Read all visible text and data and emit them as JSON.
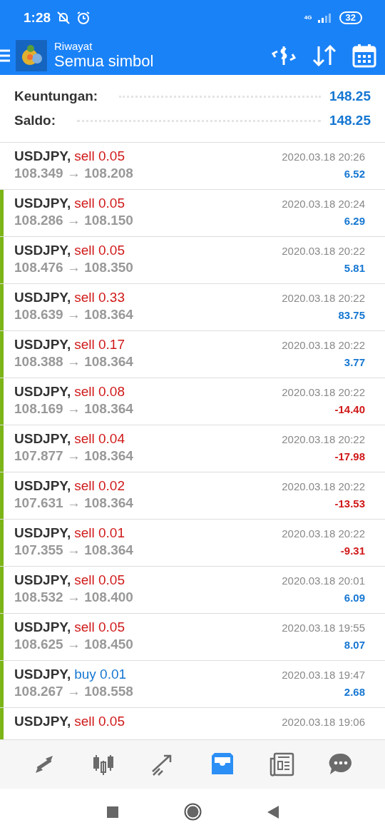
{
  "status_bar": {
    "time": "1:28",
    "network": "4G",
    "battery": "32"
  },
  "header": {
    "title": "Riwayat",
    "subtitle": "Semua simbol"
  },
  "summary": [
    {
      "label": "Keuntungan:",
      "value": "148.25"
    },
    {
      "label": "Saldo:",
      "value": "148.25"
    }
  ],
  "deals": [
    {
      "symbol": "USDJPY,",
      "type": "sell",
      "volume": "0.05",
      "buy": false,
      "prices": "108.349 → 108.208",
      "time": "2020.03.18 20:26",
      "profit": "6.52",
      "loss": false,
      "marked": false
    },
    {
      "symbol": "USDJPY,",
      "type": "sell",
      "volume": "0.05",
      "buy": false,
      "prices": "108.286 → 108.150",
      "time": "2020.03.18 20:24",
      "profit": "6.29",
      "loss": false,
      "marked": true
    },
    {
      "symbol": "USDJPY,",
      "type": "sell",
      "volume": "0.05",
      "buy": false,
      "prices": "108.476 → 108.350",
      "time": "2020.03.18 20:22",
      "profit": "5.81",
      "loss": false,
      "marked": true
    },
    {
      "symbol": "USDJPY,",
      "type": "sell",
      "volume": "0.33",
      "buy": false,
      "prices": "108.639 → 108.364",
      "time": "2020.03.18 20:22",
      "profit": "83.75",
      "loss": false,
      "marked": true
    },
    {
      "symbol": "USDJPY,",
      "type": "sell",
      "volume": "0.17",
      "buy": false,
      "prices": "108.388 → 108.364",
      "time": "2020.03.18 20:22",
      "profit": "3.77",
      "loss": false,
      "marked": true
    },
    {
      "symbol": "USDJPY,",
      "type": "sell",
      "volume": "0.08",
      "buy": false,
      "prices": "108.169 → 108.364",
      "time": "2020.03.18 20:22",
      "profit": "-14.40",
      "loss": true,
      "marked": true
    },
    {
      "symbol": "USDJPY,",
      "type": "sell",
      "volume": "0.04",
      "buy": false,
      "prices": "107.877 → 108.364",
      "time": "2020.03.18 20:22",
      "profit": "-17.98",
      "loss": true,
      "marked": true
    },
    {
      "symbol": "USDJPY,",
      "type": "sell",
      "volume": "0.02",
      "buy": false,
      "prices": "107.631 → 108.364",
      "time": "2020.03.18 20:22",
      "profit": "-13.53",
      "loss": true,
      "marked": true
    },
    {
      "symbol": "USDJPY,",
      "type": "sell",
      "volume": "0.01",
      "buy": false,
      "prices": "107.355 → 108.364",
      "time": "2020.03.18 20:22",
      "profit": "-9.31",
      "loss": true,
      "marked": true
    },
    {
      "symbol": "USDJPY,",
      "type": "sell",
      "volume": "0.05",
      "buy": false,
      "prices": "108.532 → 108.400",
      "time": "2020.03.18 20:01",
      "profit": "6.09",
      "loss": false,
      "marked": true
    },
    {
      "symbol": "USDJPY,",
      "type": "sell",
      "volume": "0.05",
      "buy": false,
      "prices": "108.625 → 108.450",
      "time": "2020.03.18 19:55",
      "profit": "8.07",
      "loss": false,
      "marked": true
    },
    {
      "symbol": "USDJPY,",
      "type": "buy",
      "volume": "0.01",
      "buy": true,
      "prices": "108.267 → 108.558",
      "time": "2020.03.18 19:47",
      "profit": "2.68",
      "loss": false,
      "marked": true
    },
    {
      "symbol": "USDJPY,",
      "type": "sell",
      "volume": "0.05",
      "buy": false,
      "time": "2020.03.18 19:06",
      "marked": true
    }
  ],
  "bottom_nav": [
    {
      "kind": "quotes",
      "selected": false
    },
    {
      "kind": "chart",
      "selected": false
    },
    {
      "kind": "trade",
      "selected": false
    },
    {
      "kind": "history",
      "selected": true
    },
    {
      "kind": "news",
      "selected": false
    },
    {
      "kind": "chat",
      "selected": false
    }
  ]
}
